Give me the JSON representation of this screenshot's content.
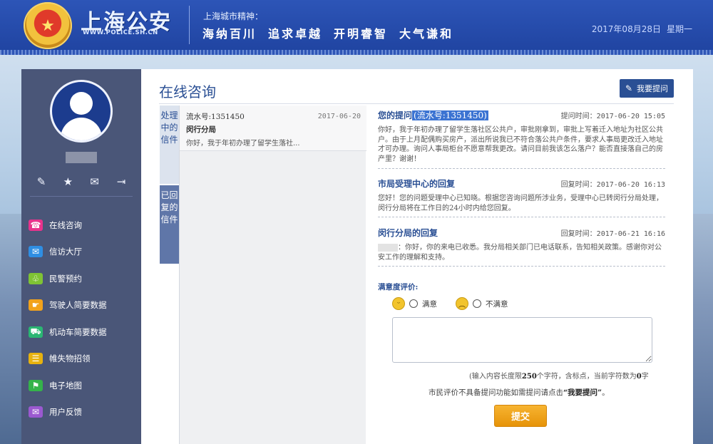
{
  "header": {
    "logo_title": "上海公安",
    "logo_url": "WWW.POLICE.SH.CN",
    "spirit_label": "上海城市精神：",
    "spirit": [
      "海纳百川",
      "追求卓越",
      "开明睿智",
      "大气谦和"
    ],
    "date": "2017年08月28日",
    "weekday": "星期一"
  },
  "sidebar": {
    "tools": [
      "pencil-icon",
      "star-icon",
      "mail-icon",
      "logout-icon"
    ],
    "nav": [
      {
        "label": "在线咨询",
        "icon": "phone-icon",
        "color": "#e8338c"
      },
      {
        "label": "信访大厅",
        "icon": "envelope-icon",
        "color": "#2f8ee3"
      },
      {
        "label": "民警预约",
        "icon": "handshake-icon",
        "color": "#7fc334"
      },
      {
        "label": "驾驶人简要数据",
        "icon": "hand-icon",
        "color": "#f2a21b"
      },
      {
        "label": "机动车简要数据",
        "icon": "car-icon",
        "color": "#2bb673"
      },
      {
        "label": "帷失物招领",
        "icon": "list-icon",
        "color": "#e7b20f"
      },
      {
        "label": "电子地图",
        "icon": "map-icon",
        "color": "#35b34a"
      },
      {
        "label": "用户反馈",
        "icon": "feedback-icon",
        "color": "#9b59d0"
      }
    ]
  },
  "main": {
    "title": "在线咨询",
    "ask_button": "我要提问",
    "tabs": [
      "处理中的信件",
      "已回复的信件"
    ],
    "list": [
      {
        "serial": "流水号:1351450",
        "date": "2017-06-20",
        "dept": "闵行分局",
        "summary": "你好，我于年初办理了留学生落社..."
      }
    ],
    "question": {
      "title_prefix": "您的提问",
      "serial": "(流水号:1351450)",
      "time": "提问时间：2017-06-20 15:05",
      "body": "你好，我于年初办理了留学生落社区公共户，审批刚拿到，审批上写着迁入地址为社区公共户。由于上月配偶购买房产，派出所说我已不符合落公共户条件，要求人事局更改迁入地址才可办理。询问人事局柜台不愿意帮我更改。请问目前我该怎么落户？能否直接落自己的房产里？谢谢！"
    },
    "reply1": {
      "title": "市局受理中心的回复",
      "time": "回复时间：2017-06-20 16:13",
      "body": "您好！您的问题受理中心已知晓。根据您咨询问题所涉业务，受理中心已转闵行分局处理，闵行分局将在工作日的24小时内给您回复。"
    },
    "reply2": {
      "title": "闵行分局的回复",
      "time": "回复时间：2017-06-21 16:16",
      "body": "：你好，你的来电已收悉。我分局相关部门已电话联系，告知相关政策。感谢你对公安工作的理解和支持。"
    },
    "rating": {
      "label": "满意度评价:",
      "satisfied": "满意",
      "unsatisfied": "不满意"
    },
    "limit": {
      "pre": "(输入内容长度限",
      "max": "250",
      "mid": "个字符，含标点，当前字符数为",
      "cur": "0",
      "post": "字"
    },
    "note": {
      "pre": "市民评价不具备提问功能如需提问请点击",
      "link": "“我要提问”",
      "post": "。"
    },
    "submit": "提交"
  }
}
